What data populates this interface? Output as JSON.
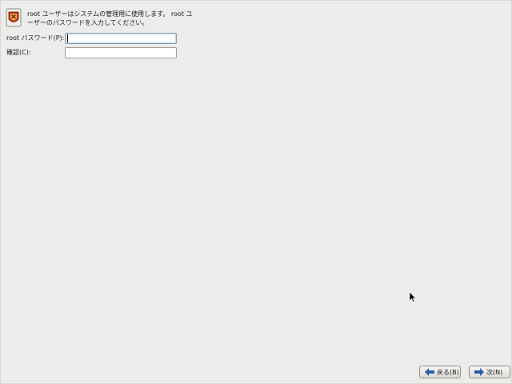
{
  "header": {
    "icon": "root-shield-icon",
    "description": "root ユーザーはシステムの管理用に使用します。 root ユーザーのパスワードを入力してください。"
  },
  "form": {
    "password_label": "root パスワード(P):",
    "password_value": "",
    "confirm_label": "確認(C):",
    "confirm_value": ""
  },
  "nav": {
    "back_label": "戻る(B)",
    "next_label": "次(N)",
    "arrow_color": "#2a5ea8"
  }
}
